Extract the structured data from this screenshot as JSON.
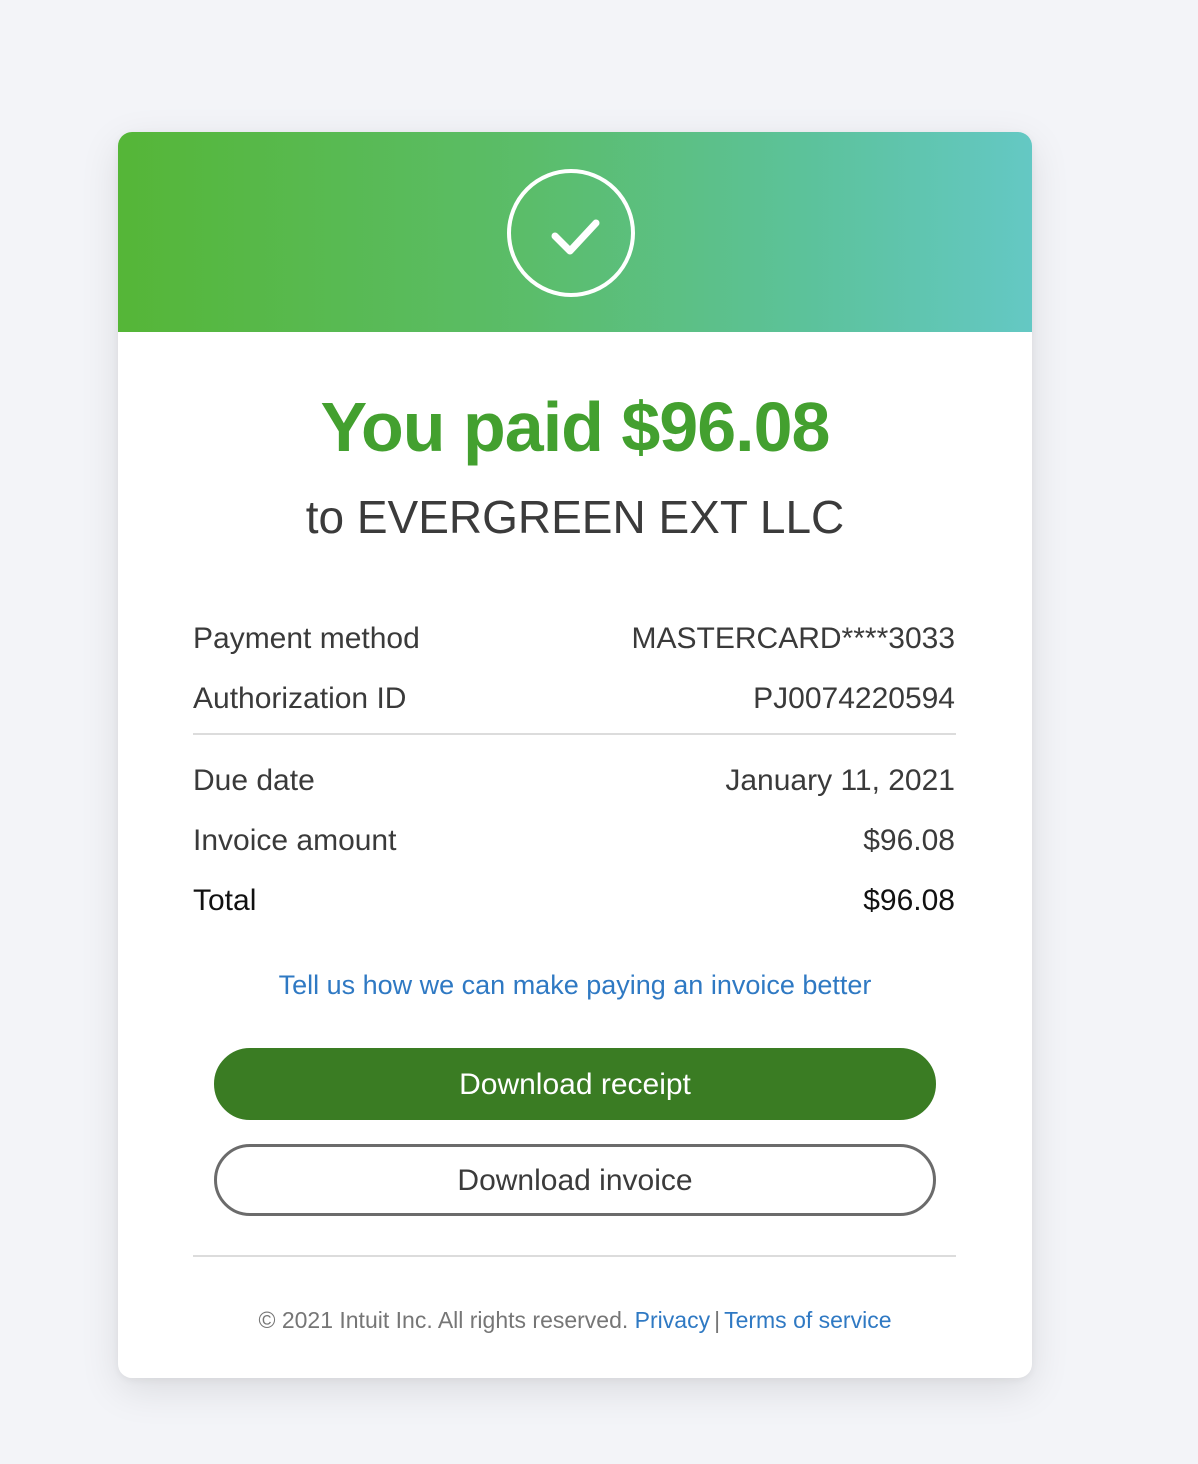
{
  "header": {
    "status_icon": "checkmark-circle-icon",
    "gradient_colors": [
      "#55b637",
      "#64c8c4"
    ]
  },
  "summary": {
    "headline": "You paid $96.08",
    "payee": "to EVERGREEN EXT LLC",
    "headline_color": "#43a02f"
  },
  "payment_details": [
    {
      "label": "Payment method",
      "value": "MASTERCARD****3033"
    },
    {
      "label": "Authorization ID",
      "value": "PJ0074220594"
    }
  ],
  "invoice_details": [
    {
      "label": "Due date",
      "value": "January 11, 2021"
    },
    {
      "label": "Invoice amount",
      "value": "$96.08"
    }
  ],
  "total": {
    "label": "Total",
    "value": "$96.08"
  },
  "feedback_link": "Tell us how we can make paying an invoice better",
  "actions": {
    "download_receipt": "Download receipt",
    "download_invoice": "Download invoice",
    "primary_color": "#3a7c23"
  },
  "footer": {
    "copyright": "© 2021 Intuit Inc. All rights reserved.",
    "privacy": "Privacy",
    "separator": "|",
    "terms": "Terms of service",
    "link_color": "#2f79c3"
  }
}
